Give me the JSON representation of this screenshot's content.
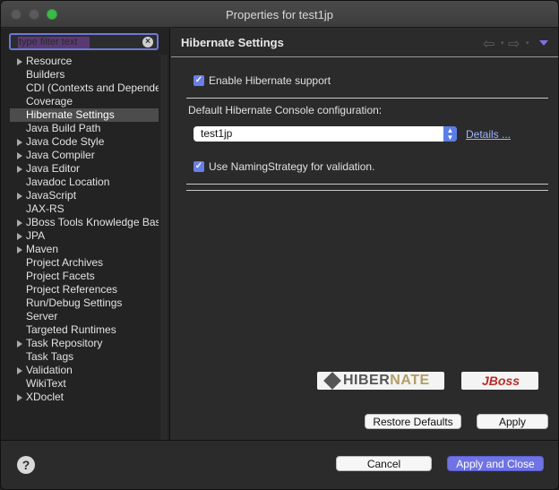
{
  "window": {
    "title": "Properties for test1jp"
  },
  "filter": {
    "placeholder": "type filter text"
  },
  "tree": {
    "items": [
      {
        "label": "Resource",
        "expandable": true
      },
      {
        "label": "Builders",
        "expandable": false
      },
      {
        "label": "CDI (Contexts and Dependency Injection)",
        "expandable": false
      },
      {
        "label": "Coverage",
        "expandable": false
      },
      {
        "label": "Hibernate Settings",
        "expandable": false,
        "selected": true
      },
      {
        "label": "Java Build Path",
        "expandable": false
      },
      {
        "label": "Java Code Style",
        "expandable": true
      },
      {
        "label": "Java Compiler",
        "expandable": true
      },
      {
        "label": "Java Editor",
        "expandable": true
      },
      {
        "label": "Javadoc Location",
        "expandable": false
      },
      {
        "label": "JavaScript",
        "expandable": true
      },
      {
        "label": "JAX-RS",
        "expandable": false
      },
      {
        "label": "JBoss Tools Knowledge Base",
        "expandable": true
      },
      {
        "label": "JPA",
        "expandable": true
      },
      {
        "label": "Maven",
        "expandable": true
      },
      {
        "label": "Project Archives",
        "expandable": false
      },
      {
        "label": "Project Facets",
        "expandable": false
      },
      {
        "label": "Project References",
        "expandable": false
      },
      {
        "label": "Run/Debug Settings",
        "expandable": false
      },
      {
        "label": "Server",
        "expandable": false
      },
      {
        "label": "Targeted Runtimes",
        "expandable": false
      },
      {
        "label": "Task Repository",
        "expandable": true
      },
      {
        "label": "Task Tags",
        "expandable": false
      },
      {
        "label": "Validation",
        "expandable": true
      },
      {
        "label": "WikiText",
        "expandable": false
      },
      {
        "label": "XDoclet",
        "expandable": true
      }
    ]
  },
  "page": {
    "title": "Hibernate Settings",
    "enable_label": "Enable Hibernate support",
    "enable_checked": true,
    "console_heading": "Default Hibernate Console configuration:",
    "console_value": "test1jp",
    "details_link": "Details ...",
    "naming_label": "Use NamingStrategy for validation.",
    "naming_checked": true,
    "logos": {
      "hibernate": "HIBERNATE",
      "jboss": "JBoss"
    },
    "restore_defaults": "Restore Defaults",
    "apply": "Apply"
  },
  "footer": {
    "help_icon": "?",
    "cancel": "Cancel",
    "apply_close": "Apply and Close"
  },
  "colors": {
    "accent": "#6f73e3",
    "checkbox": "#6a7ee8",
    "link": "#9fb6ff"
  }
}
